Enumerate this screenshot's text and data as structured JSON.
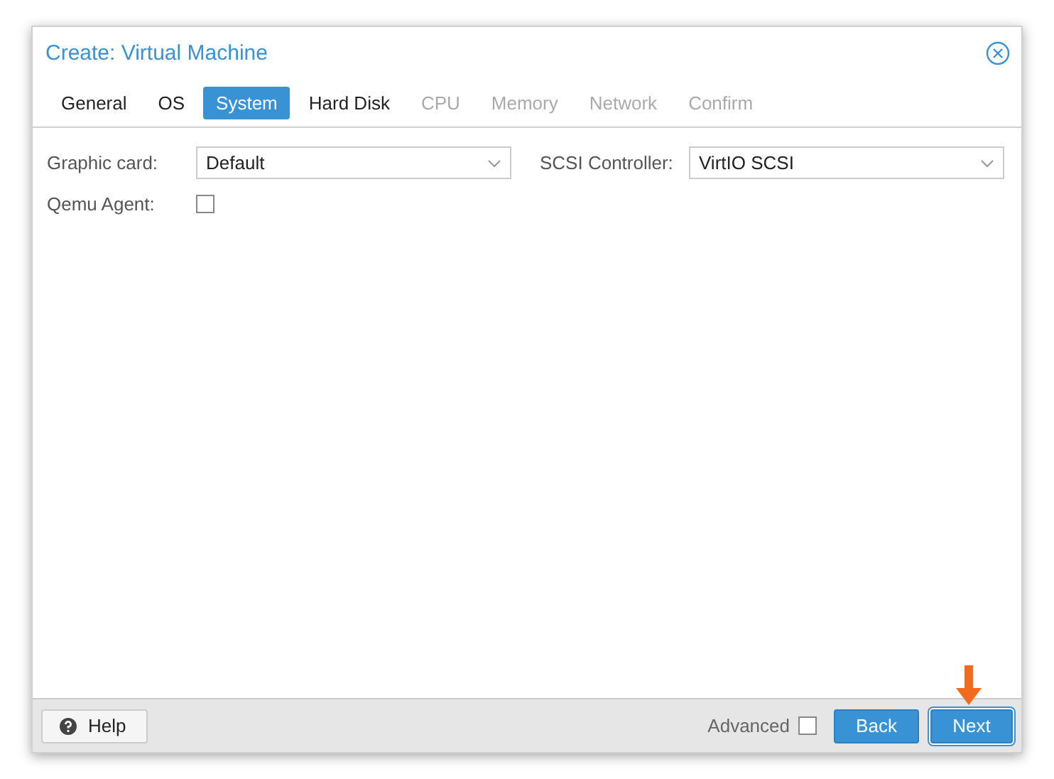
{
  "window": {
    "title": "Create: Virtual Machine"
  },
  "tabs": [
    {
      "label": "General",
      "selected": false,
      "disabled": false
    },
    {
      "label": "OS",
      "selected": false,
      "disabled": false
    },
    {
      "label": "System",
      "selected": true,
      "disabled": false
    },
    {
      "label": "Hard Disk",
      "selected": false,
      "disabled": false
    },
    {
      "label": "CPU",
      "selected": false,
      "disabled": true
    },
    {
      "label": "Memory",
      "selected": false,
      "disabled": true
    },
    {
      "label": "Network",
      "selected": false,
      "disabled": true
    },
    {
      "label": "Confirm",
      "selected": false,
      "disabled": true
    }
  ],
  "form": {
    "graphic_card": {
      "label": "Graphic card:",
      "value": "Default"
    },
    "scsi_controller": {
      "label": "SCSI Controller:",
      "value": "VirtIO SCSI"
    },
    "qemu_agent": {
      "label": "Qemu Agent:",
      "checked": false
    }
  },
  "footer": {
    "help": "Help",
    "advanced": {
      "label": "Advanced",
      "checked": false
    },
    "back": "Back",
    "next": "Next"
  }
}
